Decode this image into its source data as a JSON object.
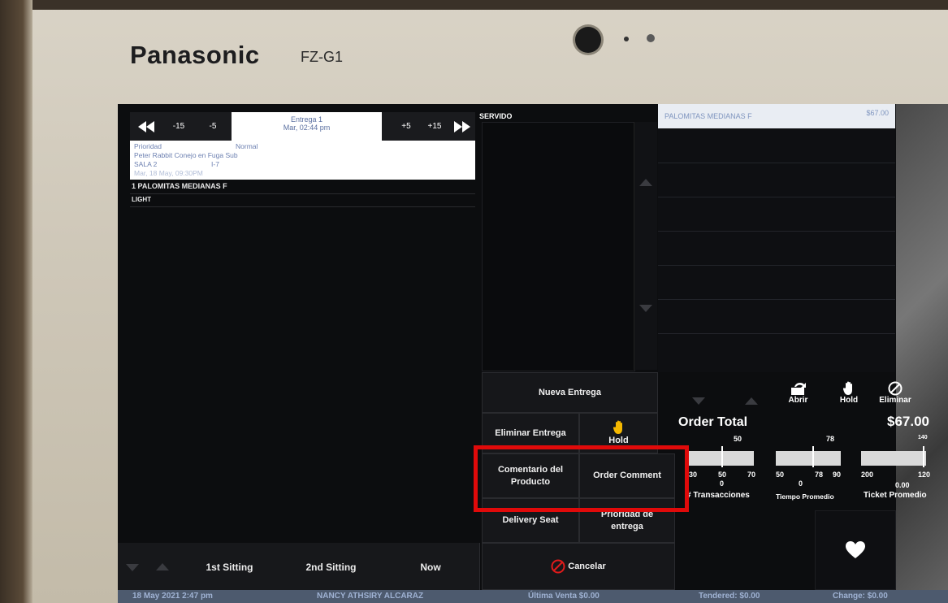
{
  "device": {
    "brand": "Panasonic",
    "model": "FZ-G1"
  },
  "topbar": {
    "rewind_icon": "double-left-arrow",
    "minus15": "-15",
    "minus5": "-5",
    "entrega_title": "Entrega 1",
    "entrega_time": "Mar, 02:44 pm",
    "plus5": "+5",
    "plus15": "+15",
    "forward_icon": "double-right-arrow"
  },
  "order_card": {
    "priority_label": "Prioridad",
    "priority_value": "Normal",
    "movie": "Peter Rabbit Conejo en Fuga Sub",
    "room": "SALA 2",
    "seat": "I-7",
    "date": "Mar, 18 May, 09:30PM"
  },
  "items": [
    {
      "text": "1  PALOMITAS MEDIANAS F"
    },
    {
      "text": "LIGHT"
    }
  ],
  "middle": {
    "header": "SERVIDO",
    "nueva_entrega": "Nueva Entrega",
    "eliminar_entrega": "Eliminar Entrega",
    "hold": "Hold",
    "comentario_producto": "Comentario del Producto",
    "order_comment": "Order Comment",
    "delivery_seat": "Delivery Seat",
    "prioridad_entrega": "Prioridad de entrega",
    "cancelar": "Cancelar"
  },
  "bottom_left": {
    "sitting1": "1st Sitting",
    "sitting2": "2nd Sitting",
    "now": "Now"
  },
  "right": {
    "header_item": "PALOMITAS MEDIANAS F",
    "header_price": "$67.00",
    "abrir": "Abrir",
    "hold": "Hold",
    "eliminar": "Eliminar",
    "order_total_label": "Order Total",
    "order_total_value": "$67.00"
  },
  "gauges": [
    {
      "label": "# Transacciones",
      "target": "50",
      "min": "30",
      "mid": "50",
      "max": "70",
      "value": "0",
      "fraction": 0.0
    },
    {
      "label": "Tiempo Promedio",
      "target": "78",
      "min": "50",
      "mid": "78",
      "max": "90",
      "value": "0",
      "fraction": 0.0
    },
    {
      "label": "Ticket Promedio",
      "target": "140",
      "min": "200",
      "max": "120",
      "value": "0.00",
      "fraction": 0.0
    }
  ],
  "status_bar": {
    "datetime": "18 May 2021 2:47 pm",
    "user": "NANCY ATHSIRY ALCARAZ",
    "ultima_venta": "Última Venta $0.00",
    "tendered": "Tendered: $0.00",
    "change": "Change: $0.00"
  },
  "colors": {
    "highlight_box": "#e00a0a",
    "hold_icon": "#f5b800"
  }
}
